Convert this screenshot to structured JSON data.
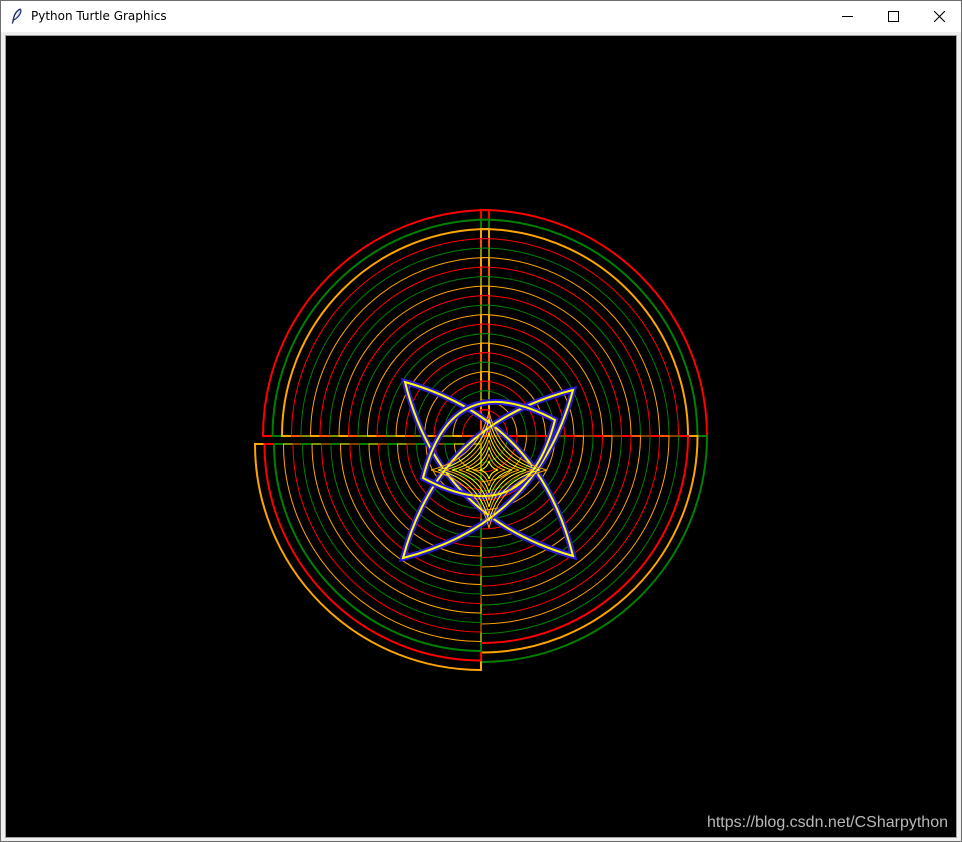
{
  "window": {
    "title": "Python Turtle Graphics",
    "icon": "feather-icon"
  },
  "controls": {
    "minimize": "minimize-icon",
    "maximize": "maximize-icon",
    "close": "close-icon"
  },
  "canvas": {
    "background": "#000000",
    "watermark": "https://blog.csdn.net/CSharpython"
  },
  "colors": {
    "red": "#ff0000",
    "green": "#008000",
    "orange": "#ffa500",
    "yellow": "#ffff00",
    "blue": "#2b1ad8"
  }
}
